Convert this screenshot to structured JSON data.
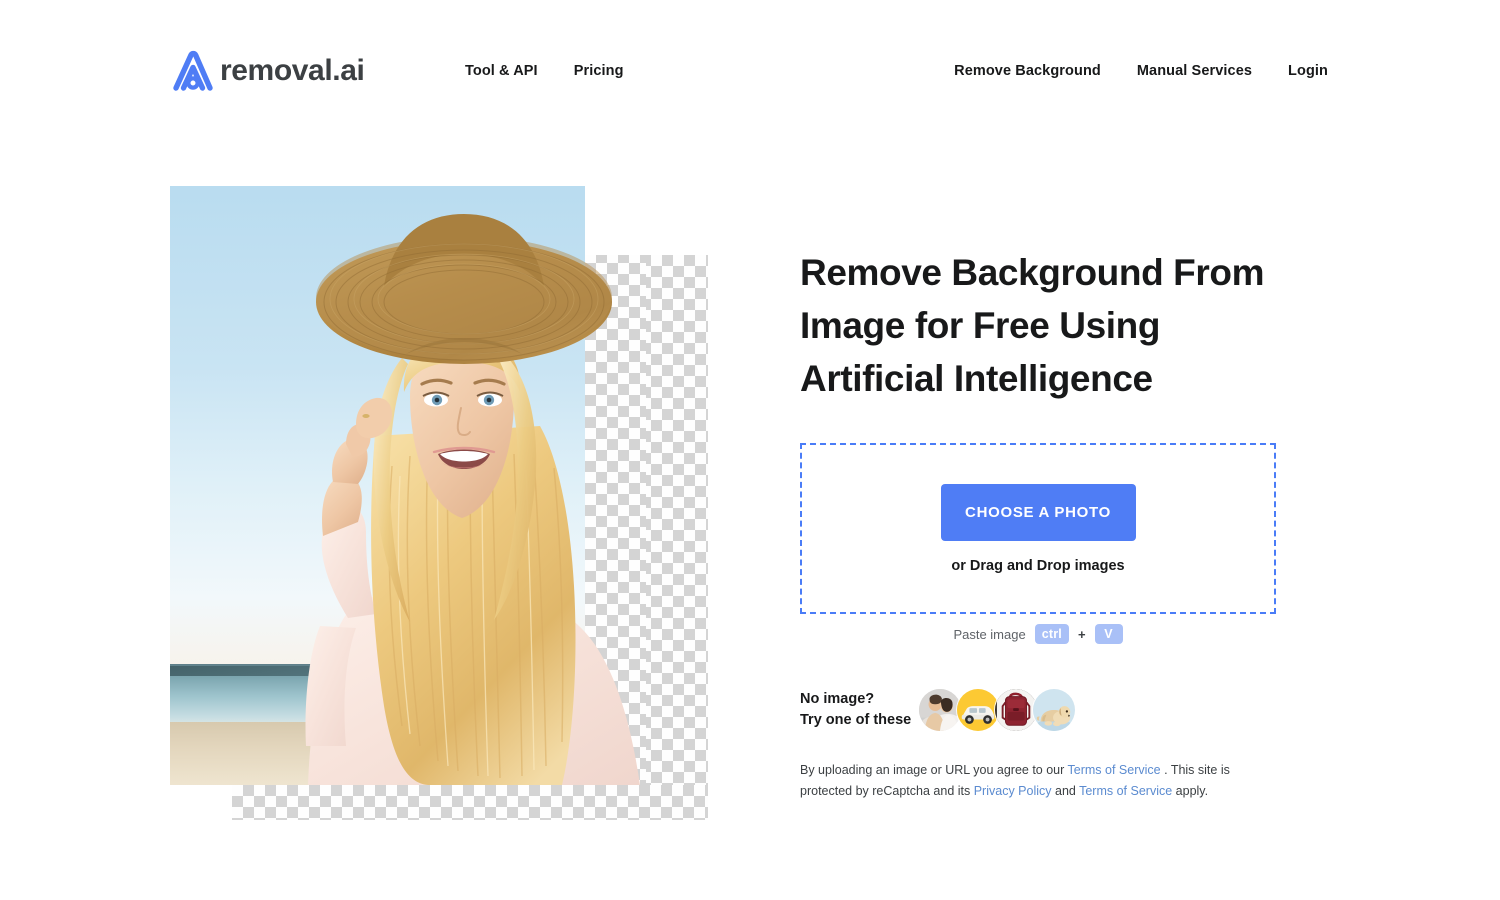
{
  "header": {
    "brand": {
      "name": "removal.ai",
      "logo_icon": "removal-ai-logo-icon",
      "color": "#4f7df5"
    },
    "nav_left": [
      {
        "label": "Tool & API"
      },
      {
        "label": "Pricing"
      }
    ],
    "nav_right": [
      {
        "label": "Remove Background"
      },
      {
        "label": "Manual Services"
      },
      {
        "label": "Login"
      }
    ]
  },
  "hero": {
    "image_alt": "Smiling blonde woman in straw hat at the beach with background partially removed showing transparency checkerboard"
  },
  "main": {
    "headline": "Remove Background From Image for Free Using Artificial Intelligence",
    "dropzone": {
      "button_label": "CHOOSE A PHOTO",
      "drag_text": "or Drag and Drop images",
      "border_color": "#4a7cf7",
      "button_color": "#4f7df5"
    },
    "paste_hint": {
      "label": "Paste image",
      "key1": "ctrl",
      "separator": "+",
      "key2": "V"
    },
    "samples": {
      "line1": "No image?",
      "line2": "Try one of these",
      "items": [
        {
          "name": "sample-couple",
          "alt": "couple portrait"
        },
        {
          "name": "sample-car",
          "alt": "white car on yellow background"
        },
        {
          "name": "sample-backpack",
          "alt": "red backpack"
        },
        {
          "name": "sample-dog",
          "alt": "golden retriever dog"
        }
      ]
    },
    "legal": {
      "part1": "By uploading an image or URL you agree to our ",
      "link1": "Terms of Service",
      "part2": " . This site is protected by reCaptcha and its ",
      "link2": "Privacy Policy",
      "part3": " and ",
      "link3": "Terms of Service",
      "part4": " apply.",
      "link_color": "#5b8bd0"
    }
  }
}
